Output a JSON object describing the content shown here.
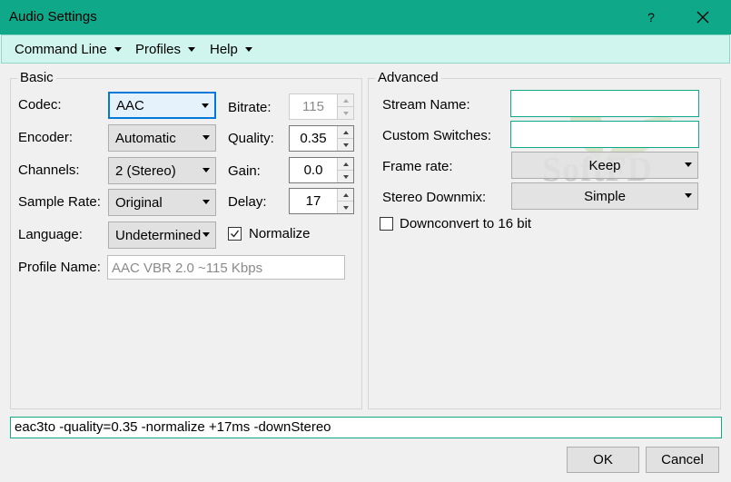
{
  "window": {
    "title": "Audio Settings",
    "help_glyph": "?"
  },
  "menu": {
    "command_line": "Command Line",
    "profiles": "Profiles",
    "help": "Help"
  },
  "basic": {
    "label": "Basic",
    "codec": {
      "label": "Codec:",
      "value": "AAC"
    },
    "encoder": {
      "label": "Encoder:",
      "value": "Automatic"
    },
    "channels": {
      "label": "Channels:",
      "value": "2 (Stereo)"
    },
    "sample_rate": {
      "label": "Sample Rate:",
      "value": "Original"
    },
    "language": {
      "label": "Language:",
      "value": "Undetermined"
    },
    "bitrate": {
      "label": "Bitrate:",
      "value": "115"
    },
    "quality": {
      "label": "Quality:",
      "value": "0.35"
    },
    "gain": {
      "label": "Gain:",
      "value": "0.0"
    },
    "delay": {
      "label": "Delay:",
      "value": "17"
    },
    "normalize": {
      "label": "Normalize",
      "checked": true
    },
    "profile_name": {
      "label": "Profile Name:",
      "value": "AAC VBR 2.0 ~115 Kbps"
    }
  },
  "advanced": {
    "label": "Advanced",
    "stream_name": {
      "label": "Stream Name:",
      "value": ""
    },
    "custom_switches": {
      "label": "Custom Switches:",
      "value": ""
    },
    "frame_rate": {
      "label": "Frame rate:",
      "value": "Keep"
    },
    "stereo_downmix": {
      "label": "Stereo Downmix:",
      "value": "Simple"
    },
    "downconvert": {
      "label": "Downconvert to 16 bit",
      "checked": false
    }
  },
  "command_line_value": "eac3to -quality=0.35 -normalize +17ms -downStereo",
  "buttons": {
    "ok": "OK",
    "cancel": "Cancel"
  },
  "watermark": {
    "text": "SoftFD"
  },
  "colors": {
    "titlebar": "#0fa98a",
    "menubar": "#cff5ee",
    "accent": "#0078d7"
  }
}
